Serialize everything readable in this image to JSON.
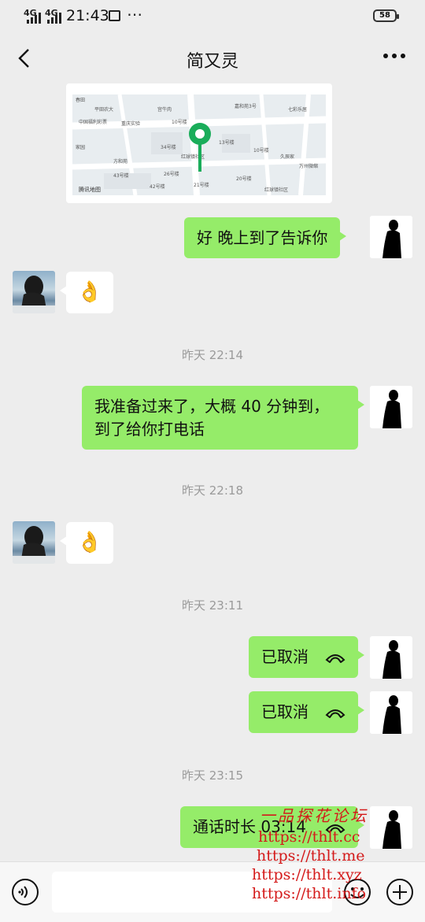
{
  "status": {
    "signal1": "4G",
    "signal2": "4G",
    "time": "21:43",
    "more": "⋯",
    "battery": "58"
  },
  "header": {
    "title": "简又灵"
  },
  "map": {
    "labels": [
      "春田",
      "平田农大",
      "宫牛肉",
      "嘉和苑3号",
      "七彩乐居",
      "中国福利彩票",
      "重庆实验",
      "10号楼",
      "13号楼",
      "家园",
      "34号楼",
      "红球镇社区",
      "10号楼",
      "久辰家",
      "万州微缩",
      "方和苑",
      "26号楼",
      "43号楼",
      "42号楼",
      "腾讯地图",
      "21号楼",
      "20号楼",
      "红球镇社区"
    ]
  },
  "messages": {
    "m1": "好 晚上到了告诉你",
    "m2_emoji": "👌",
    "t1": "昨天 22:14",
    "m3_line1": "我准备过来了，大概 40 分钟到，",
    "m3_line2": "到了给你打电话",
    "t2": "昨天 22:18",
    "m4_emoji": "👌",
    "t3": "昨天 23:11",
    "m5": "已取消",
    "m6": "已取消",
    "t4": "昨天 23:15",
    "m7": "通话时长 03:14"
  },
  "watermark": {
    "title": "一品探花论坛",
    "urls": [
      "https://thlt.cc",
      "https://thlt.me",
      "https://thlt.xyz",
      "https://thlt.info"
    ]
  },
  "colors": {
    "my_bubble": "#95ec69",
    "map_pin": "#1aad5a",
    "background": "#ededed",
    "watermark": "#d41a1a"
  }
}
